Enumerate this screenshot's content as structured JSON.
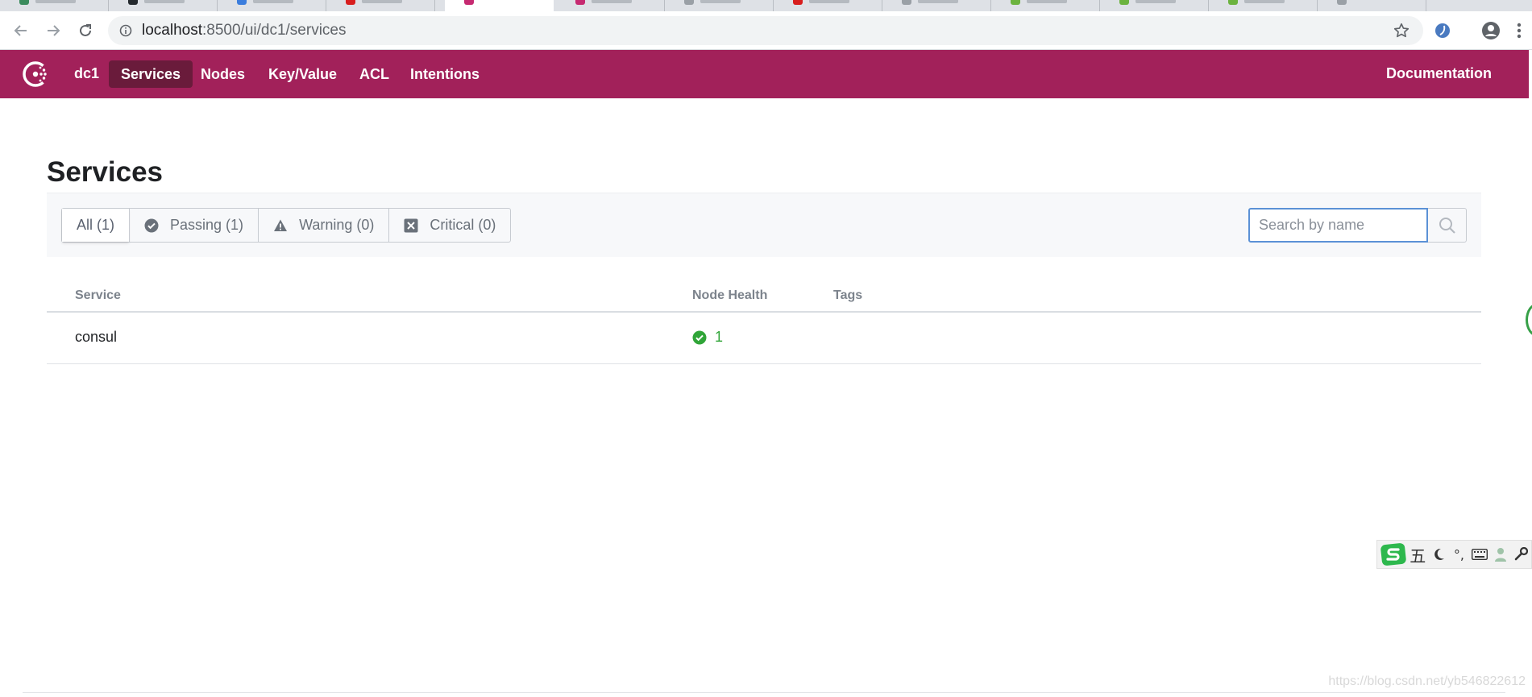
{
  "browser": {
    "url_host": "localhost",
    "url_path": ":8500/ui/dc1/services"
  },
  "app": {
    "datacenter": "dc1",
    "nav": [
      {
        "label": "Services",
        "active": true
      },
      {
        "label": "Nodes",
        "active": false
      },
      {
        "label": "Key/Value",
        "active": false
      },
      {
        "label": "ACL",
        "active": false
      },
      {
        "label": "Intentions",
        "active": false
      }
    ],
    "documentation_label": "Documentation",
    "brand_color": "#a2215a"
  },
  "page": {
    "title": "Services",
    "filters": {
      "all": "All (1)",
      "passing": "Passing (1)",
      "warning": "Warning (0)",
      "critical": "Critical (0)"
    },
    "search": {
      "placeholder": "Search by name",
      "value": ""
    }
  },
  "table": {
    "columns": {
      "service": "Service",
      "node_health": "Node Health",
      "tags": "Tags"
    },
    "rows": [
      {
        "service": "consul",
        "node_health": "1",
        "tags": ""
      }
    ]
  },
  "ime": {
    "mode_char": "五",
    "punct": "°,"
  },
  "watermark": "https://blog.csdn.net/yb546822612"
}
